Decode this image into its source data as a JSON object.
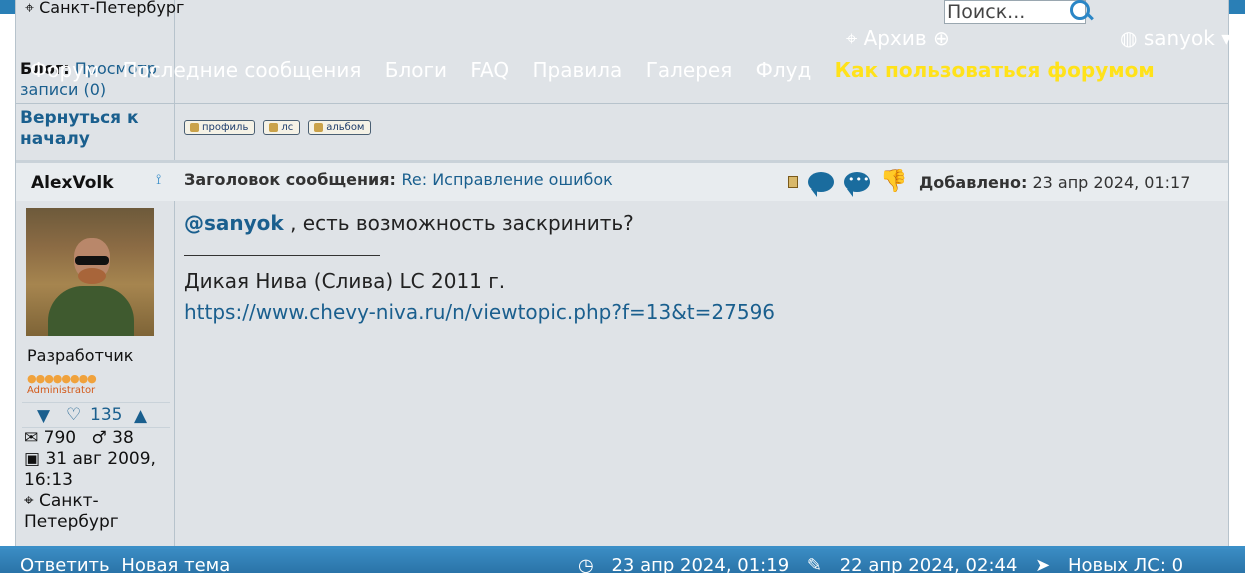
{
  "header": {
    "search_placeholder": "Поиск...",
    "archive_label": "Архив",
    "username": "sanyok",
    "nav": [
      "Форум",
      "Последние сообщения",
      "Блоги",
      "FAQ",
      "Правила",
      "Галерея",
      "Флуд",
      "Как пользоваться форумом"
    ]
  },
  "prev_post": {
    "location": "Санкт-Петербург",
    "blog_label": "Блог:",
    "blog_link": "Просмотр записи (0)",
    "back_link": "Вернуться к началу",
    "buttons": [
      "профиль",
      "лс",
      "альбом"
    ]
  },
  "post": {
    "author": "AlexVolk",
    "subject_label": "Заголовок сообщения:",
    "subject": "Re: Исправление ошибок",
    "added_label": "Добавлено:",
    "added_date": "23 апр 2024, 01:17",
    "role": "Разработчик",
    "rank_text": "Administrator",
    "reputation": "135",
    "messages": "790",
    "age": "38",
    "registered": "31 авг 2009, 16:13",
    "location": "Санкт-Петербург",
    "mention": "@sanyok",
    "body": ", есть возможность заскринить?",
    "sig_line1": "Дикая Нива (Слива) LC 2011 г.",
    "sig_link": "https://www.chevy-niva.ru/n/viewtopic.php?f=13&t=27596"
  },
  "footer": {
    "reply_label": "Ответить",
    "new_topic_label": "Новая тема",
    "time1": "23 апр 2024, 01:19",
    "time2": "22 апр 2024, 02:44",
    "new_pm_label": "Новых ЛС: 0"
  },
  "colors": {
    "accent": "#2a7fb6",
    "link": "#1a5f8e",
    "highlight": "#ffe21a"
  }
}
